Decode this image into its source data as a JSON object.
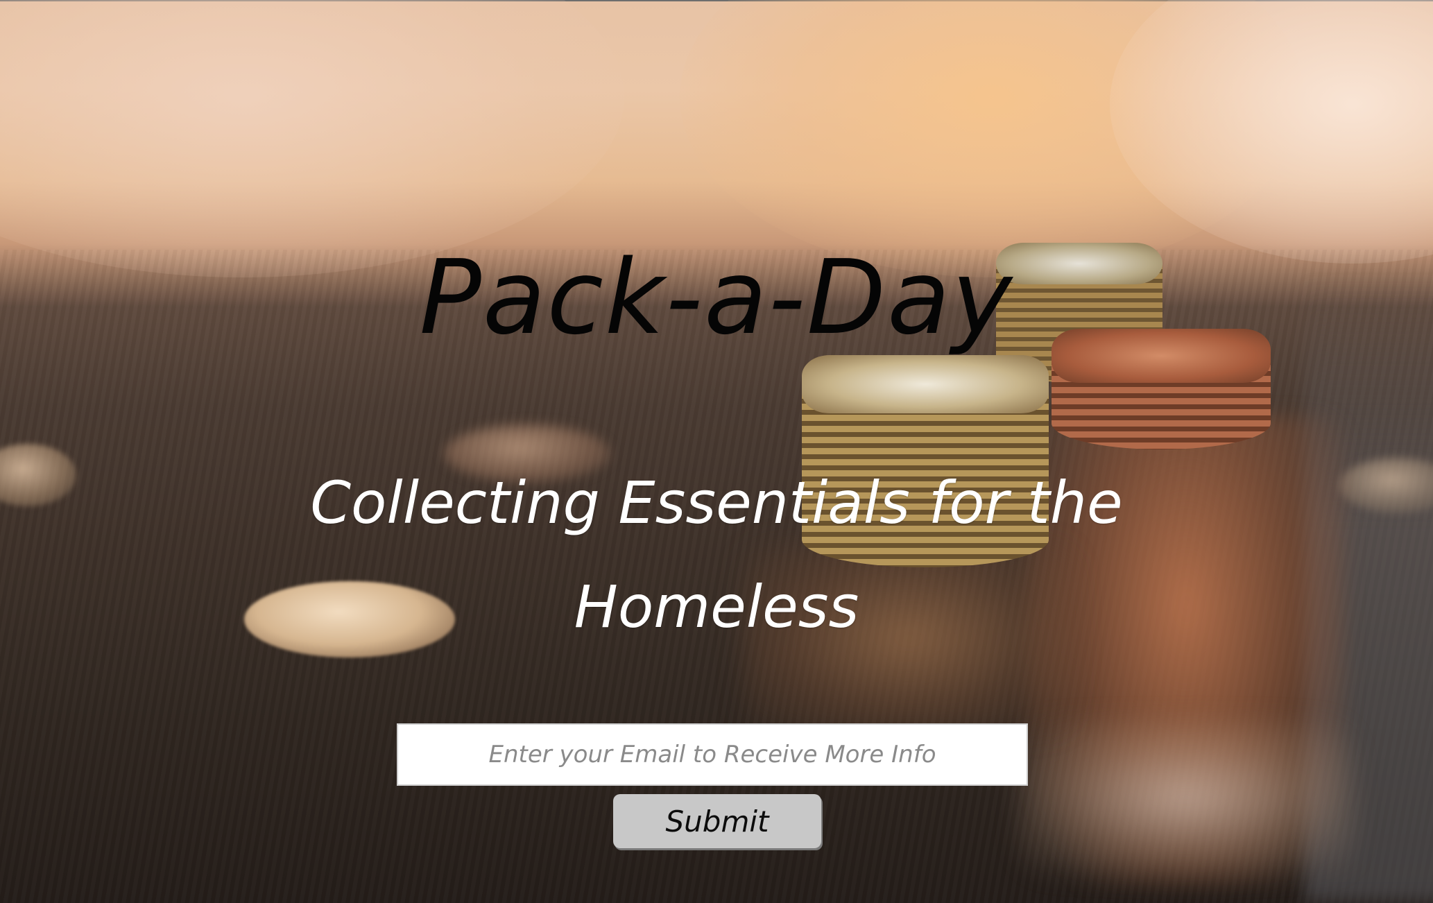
{
  "hero": {
    "title": "Pack-a-Day",
    "subtitle": "Collecting Essentials for the Homeless"
  },
  "signup": {
    "email_placeholder": "Enter your Email to Receive More Info",
    "email_value": "",
    "submit_label": "Submit"
  },
  "colors": {
    "title_text": "#050505",
    "subtitle_text": "#ffffff",
    "input_background": "#ffffff",
    "button_background": "#c8c8c8"
  },
  "background_image": "coin-stacks-on-table"
}
